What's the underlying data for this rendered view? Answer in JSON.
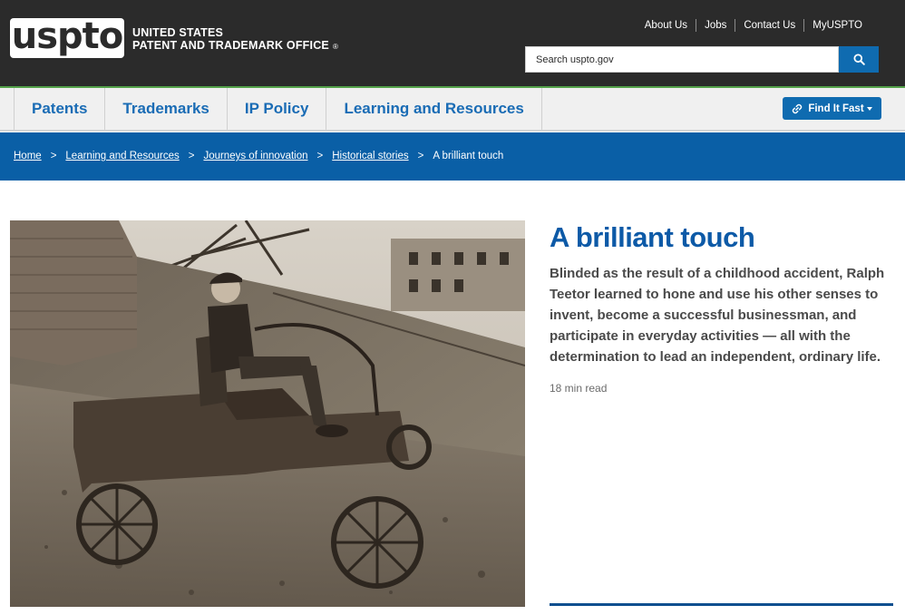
{
  "header": {
    "logo_text": "uspto",
    "agency_line1": "UNITED STATES",
    "agency_line2": "PATENT AND TRADEMARK OFFICE",
    "registered_mark": "®",
    "top_links": [
      "About Us",
      "Jobs",
      "Contact Us",
      "MyUSPTO"
    ],
    "search": {
      "placeholder": "Search uspto.gov",
      "button_icon": "search-icon"
    }
  },
  "nav": {
    "items": [
      "Patents",
      "Trademarks",
      "IP Policy",
      "Learning and Resources"
    ],
    "find_it_fast": {
      "label": "Find It Fast",
      "icon": "link-icon"
    }
  },
  "breadcrumb": {
    "links": [
      "Home",
      "Learning and Resources",
      "Journeys of innovation",
      "Historical stories"
    ],
    "current": "A brilliant touch",
    "separator": ">"
  },
  "article": {
    "title": "A brilliant touch",
    "summary": "Blinded as the result of a childhood accident, Ralph Teetor learned to hone and use his other senses to invent, become a successful businessman, and participate in everyday activities — all with the determination to lead an independent, ordinary life.",
    "read_time": "18 min read",
    "image_alt": "Boy seated in a homemade wooden motor car with spoked wheels, on a dirt hillside"
  },
  "colors": {
    "header_bg": "#2b2b2b",
    "accent_blue": "#0f6bb0",
    "breadcrumb_bg": "#0a5fa6",
    "nav_bg": "#f0f0f0",
    "title_blue": "#0d5aa7",
    "green_rule": "#54a24a"
  }
}
